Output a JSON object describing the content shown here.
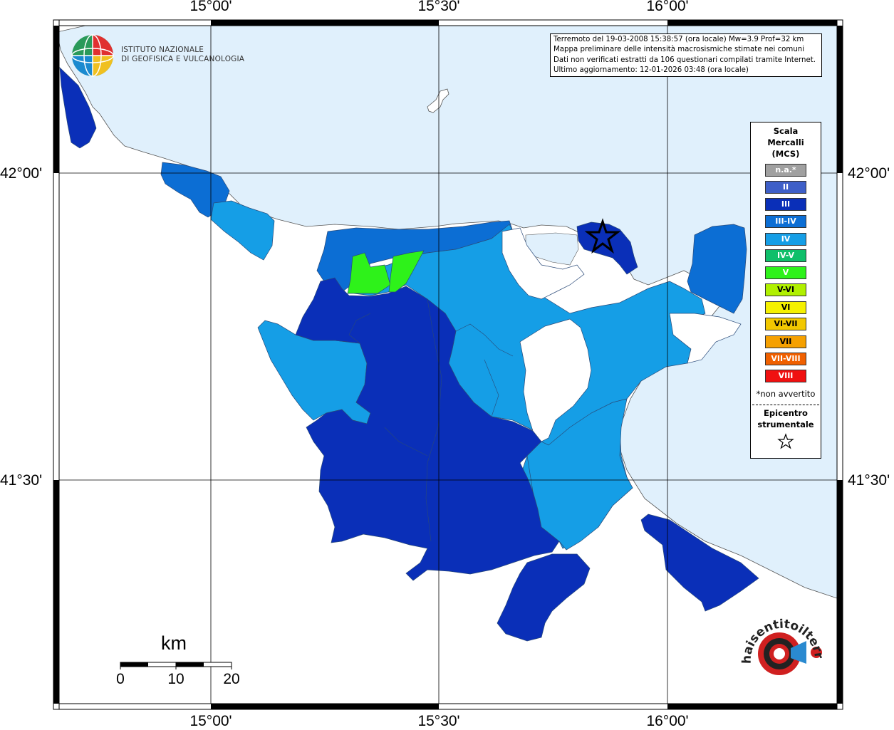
{
  "coordinates": {
    "longitudes": [
      "15°00'",
      "15°30'",
      "16°00'"
    ],
    "latitudes": [
      "42°00'",
      "41°30'"
    ]
  },
  "institute": {
    "name_line1": "ISTITUTO NAZIONALE",
    "name_line2": "DI GEOFISICA E VULCANOLOGIA"
  },
  "info": {
    "line1": "Terremoto del 19-03-2008 15:38:57 (ora locale) Mw=3.9 Prof=32 km",
    "line2": "Mappa preliminare delle intensità macrosismiche stimate nei comuni",
    "line3": "Dati non verificati estratti da 106 questionari compilati tramite Internet.",
    "line4": "Ultimo aggiornamento: 12-01-2026 03:48 (ora locale)"
  },
  "legend": {
    "title_line1": "Scala",
    "title_line2": "Mercalli",
    "title_line3": "(MCS)",
    "items": [
      {
        "label": "n.a.*",
        "color": "#a0a0a0"
      },
      {
        "label": "II",
        "color": "#3e5fc8"
      },
      {
        "label": "III",
        "color": "#0a2fb8"
      },
      {
        "label": "III-IV",
        "color": "#0c6ed4"
      },
      {
        "label": "IV",
        "color": "#159ee6"
      },
      {
        "label": "IV-V",
        "color": "#0fbf6a"
      },
      {
        "label": "V",
        "color": "#2ef21a"
      },
      {
        "label": "V-VI",
        "color": "#b0f000"
      },
      {
        "label": "VI",
        "color": "#f5f000"
      },
      {
        "label": "VI-VII",
        "color": "#f2c800"
      },
      {
        "label": "VII",
        "color": "#f5a000"
      },
      {
        "label": "VII-VIII",
        "color": "#f06000"
      },
      {
        "label": "VIII",
        "color": "#f01010"
      }
    ],
    "note": "*non avvertito",
    "epicenter_line1": "Epicentro",
    "epicenter_line2": "strumentale"
  },
  "scale_bar": {
    "unit": "km",
    "labels": [
      "0",
      "10",
      "20"
    ]
  },
  "colors": {
    "sea": "#e0f0fc",
    "intensity_III": "#0a2fb8",
    "intensity_III_IV": "#0c6ed4",
    "intensity_IV": "#159ee6",
    "intensity_V": "#2ef21a"
  },
  "watermark": "haisentitoilterremoto.it www."
}
